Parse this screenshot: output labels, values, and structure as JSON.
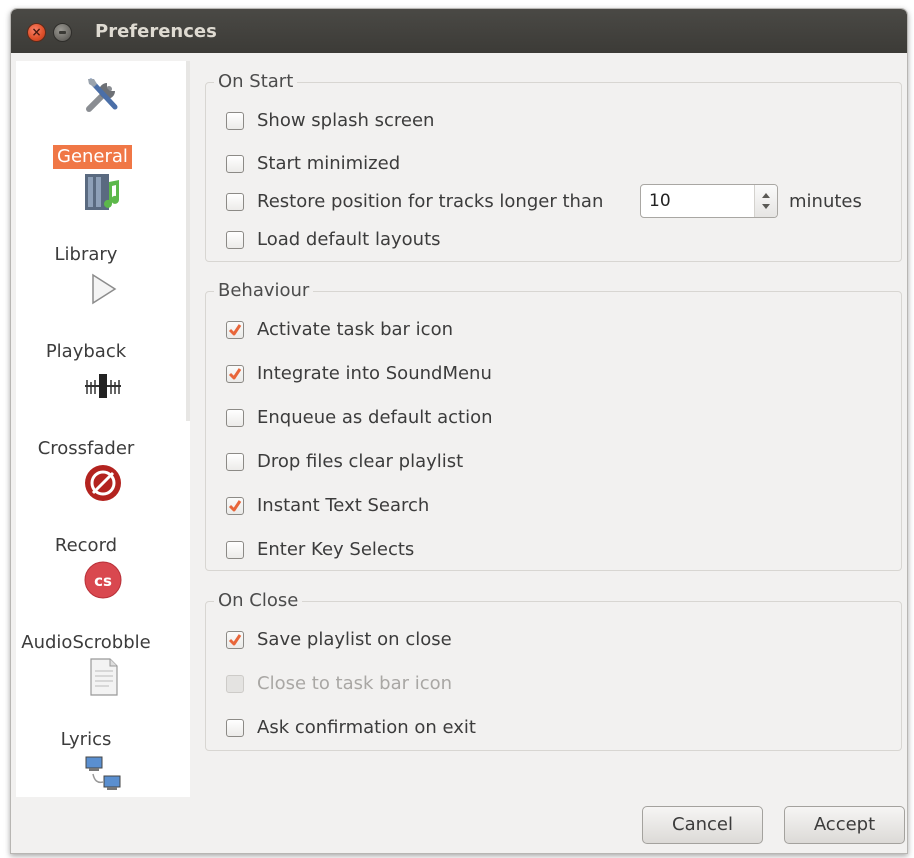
{
  "window": {
    "title": "Preferences"
  },
  "sidebar": {
    "items": [
      {
        "label": "General",
        "icon": "tools-icon",
        "selected": true
      },
      {
        "label": "Library",
        "icon": "library-music-icon"
      },
      {
        "label": "Playback",
        "icon": "play-icon"
      },
      {
        "label": "Crossfader",
        "icon": "crossfader-icon"
      },
      {
        "label": "Record",
        "icon": "record-icon"
      },
      {
        "label": "AudioScrobble",
        "icon": "lastfm-icon"
      },
      {
        "label": "Lyrics",
        "icon": "document-icon"
      },
      {
        "label": "",
        "icon": "network-icon"
      }
    ]
  },
  "on_start": {
    "title": "On Start",
    "show_splash": {
      "label": "Show splash screen",
      "checked": false
    },
    "start_minimized": {
      "label": "Start minimized",
      "checked": false
    },
    "restore_position": {
      "label": "Restore position for tracks longer than",
      "checked": false,
      "value": "10",
      "unit": "minutes"
    },
    "load_layouts": {
      "label": "Load default layouts",
      "checked": false
    }
  },
  "behaviour": {
    "title": "Behaviour",
    "items": [
      {
        "label": "Activate task bar icon",
        "checked": true
      },
      {
        "label": "Integrate into SoundMenu",
        "checked": true
      },
      {
        "label": "Enqueue as default action",
        "checked": false
      },
      {
        "label": "Drop files clear playlist",
        "checked": false
      },
      {
        "label": "Instant Text Search",
        "checked": true
      },
      {
        "label": "Enter Key Selects",
        "checked": false
      }
    ]
  },
  "on_close": {
    "title": "On Close",
    "items": [
      {
        "label": "Save playlist on close",
        "checked": true,
        "disabled": false
      },
      {
        "label": "Close to task bar icon",
        "checked": false,
        "disabled": true
      },
      {
        "label": "Ask confirmation on exit",
        "checked": false,
        "disabled": false
      }
    ]
  },
  "buttons": {
    "cancel": "Cancel",
    "accept": "Accept"
  },
  "colors": {
    "accent": "#f07746",
    "titlebar": "#3c3b37",
    "window_bg": "#f2f1f0"
  }
}
